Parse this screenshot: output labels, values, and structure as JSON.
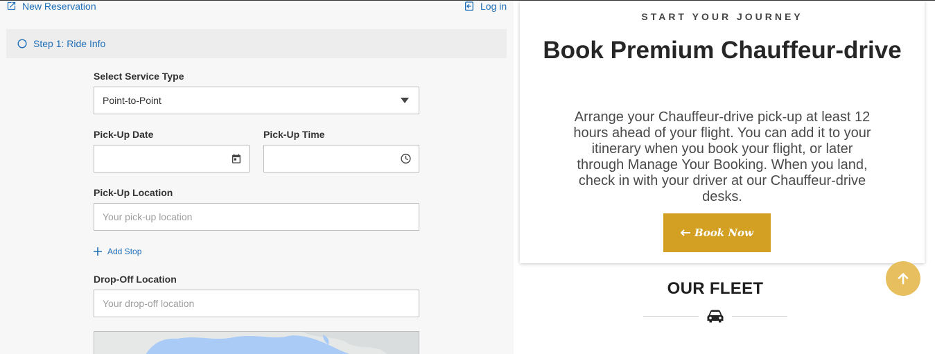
{
  "header": {
    "new_reservation": "New Reservation",
    "login": "Log in"
  },
  "step": {
    "label": "Step 1: Ride Info"
  },
  "form": {
    "service_type": {
      "label": "Select Service Type",
      "value": "Point-to-Point"
    },
    "pickup_date": {
      "label": "Pick-Up Date",
      "value": ""
    },
    "pickup_time": {
      "label": "Pick-Up Time",
      "value": ""
    },
    "pickup_location": {
      "label": "Pick-Up Location",
      "placeholder": "Your pick-up location"
    },
    "add_stop": "Add Stop",
    "dropoff_location": {
      "label": "Drop-Off Location",
      "placeholder": "Your drop-off location"
    }
  },
  "promo": {
    "eyebrow": "START YOUR JOURNEY",
    "headline": "Book Premium Chauffeur-drive",
    "description": "Arrange your Chauffeur-drive pick-up at least 12 hours ahead of your flight. You can add it to your itinerary when you book your flight, or later through Manage Your Booking. When you land, check in with your driver at our Chauffeur-drive desks.",
    "button": "Book Now"
  },
  "fleet": {
    "title": "OUR FLEET"
  },
  "colors": {
    "link": "#1e6fb8",
    "accent_gold": "#d4a024",
    "scroll_top": "#e8bf5f"
  },
  "icons": [
    "open-in-new-icon",
    "login-icon",
    "circle-outline-icon",
    "dropdown-caret-icon",
    "calendar-icon",
    "clock-icon",
    "plus-icon",
    "arrow-left-icon",
    "car-icon",
    "arrow-up-icon"
  ]
}
